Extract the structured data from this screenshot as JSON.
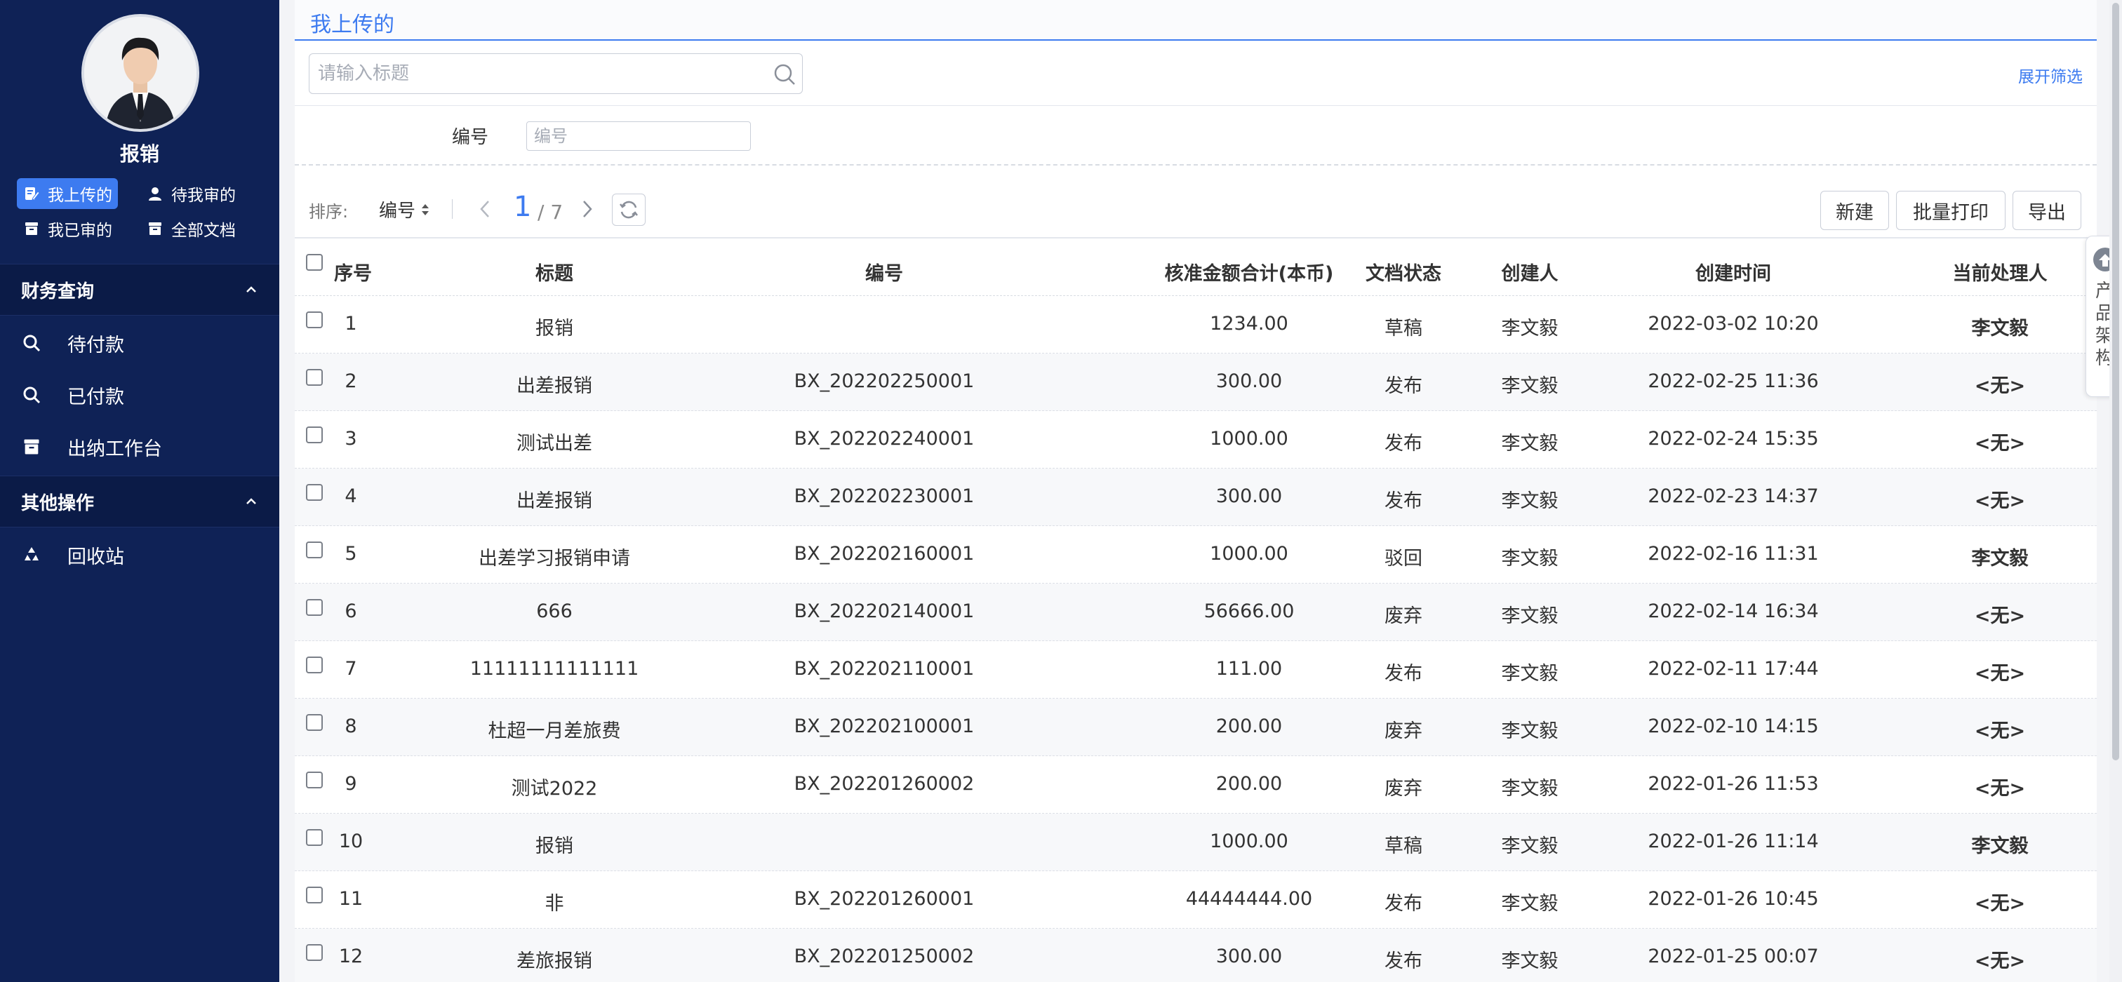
{
  "sidebar": {
    "user_name": "报销",
    "quick_links": [
      {
        "label": "我上传的",
        "icon": "edit-doc-icon",
        "active": true
      },
      {
        "label": "待我审的",
        "icon": "user-icon",
        "active": false
      },
      {
        "label": "我已审的",
        "icon": "archive-icon",
        "active": false
      },
      {
        "label": "全部文档",
        "icon": "archive-icon",
        "active": false
      }
    ],
    "groups": [
      {
        "title": "财务查询",
        "items": [
          {
            "label": "待付款",
            "icon": "search-icon"
          },
          {
            "label": "已付款",
            "icon": "search-icon"
          },
          {
            "label": "出纳工作台",
            "icon": "archive-icon"
          }
        ]
      },
      {
        "title": "其他操作",
        "items": [
          {
            "label": "回收站",
            "icon": "recycle-icon"
          }
        ]
      }
    ],
    "colors": {
      "background": "#0f2256",
      "active": "#3d7bf0"
    }
  },
  "main": {
    "page_title": "我上传的",
    "search_placeholder": "请输入标题",
    "expand_filter_label": "展开筛选",
    "filter": {
      "label": "编号",
      "placeholder": "编号"
    },
    "toolbar": {
      "sort_label": "排序:",
      "sort_value": "编号",
      "page_current": "1",
      "page_total": "/ 7",
      "buttons": {
        "new": "新建",
        "batch_print": "批量打印",
        "export": "导出"
      }
    },
    "table": {
      "columns": [
        "序号",
        "标题",
        "编号",
        "核准金额合计(本币)",
        "文档状态",
        "创建人",
        "创建时间",
        "当前处理人"
      ],
      "rows": [
        {
          "seq": "1",
          "title": "报销",
          "number": "",
          "amount": "1234.00",
          "state": "草稿",
          "creator": "李文毅",
          "time": "2022-03-02 10:20",
          "handler": "李文毅"
        },
        {
          "seq": "2",
          "title": "出差报销",
          "number": "BX_202202250001",
          "amount": "300.00",
          "state": "发布",
          "creator": "李文毅",
          "time": "2022-02-25 11:36",
          "handler": "<无>"
        },
        {
          "seq": "3",
          "title": "测试出差",
          "number": "BX_202202240001",
          "amount": "1000.00",
          "state": "发布",
          "creator": "李文毅",
          "time": "2022-02-24 15:35",
          "handler": "<无>"
        },
        {
          "seq": "4",
          "title": "出差报销",
          "number": "BX_202202230001",
          "amount": "300.00",
          "state": "发布",
          "creator": "李文毅",
          "time": "2022-02-23 14:37",
          "handler": "<无>"
        },
        {
          "seq": "5",
          "title": "出差学习报销申请",
          "number": "BX_202202160001",
          "amount": "1000.00",
          "state": "驳回",
          "creator": "李文毅",
          "time": "2022-02-16 11:31",
          "handler": "李文毅"
        },
        {
          "seq": "6",
          "title": "666",
          "number": "BX_202202140001",
          "amount": "56666.00",
          "state": "废弃",
          "creator": "李文毅",
          "time": "2022-02-14 16:34",
          "handler": "<无>"
        },
        {
          "seq": "7",
          "title": "11111111111111",
          "number": "BX_202202110001",
          "amount": "111.00",
          "state": "发布",
          "creator": "李文毅",
          "time": "2022-02-11 17:44",
          "handler": "<无>"
        },
        {
          "seq": "8",
          "title": "杜超一月差旅费",
          "number": "BX_202202100001",
          "amount": "200.00",
          "state": "废弃",
          "creator": "李文毅",
          "time": "2022-02-10 14:15",
          "handler": "<无>"
        },
        {
          "seq": "9",
          "title": "测试2022",
          "number": "BX_202201260002",
          "amount": "200.00",
          "state": "废弃",
          "creator": "李文毅",
          "time": "2022-01-26 11:53",
          "handler": "<无>"
        },
        {
          "seq": "10",
          "title": "报销",
          "number": "",
          "amount": "1000.00",
          "state": "草稿",
          "creator": "李文毅",
          "time": "2022-01-26 11:14",
          "handler": "李文毅"
        },
        {
          "seq": "11",
          "title": "非",
          "number": "BX_202201260001",
          "amount": "44444444.00",
          "state": "发布",
          "creator": "李文毅",
          "time": "2022-01-26 10:45",
          "handler": "<无>"
        },
        {
          "seq": "12",
          "title": "差旅报销",
          "number": "BX_202201250002",
          "amount": "300.00",
          "state": "发布",
          "creator": "李文毅",
          "time": "2022-01-25 00:07",
          "handler": "<无>"
        }
      ]
    }
  },
  "float_tab": {
    "label": "产品架构",
    "icon": "arrow-up-circle-icon"
  }
}
